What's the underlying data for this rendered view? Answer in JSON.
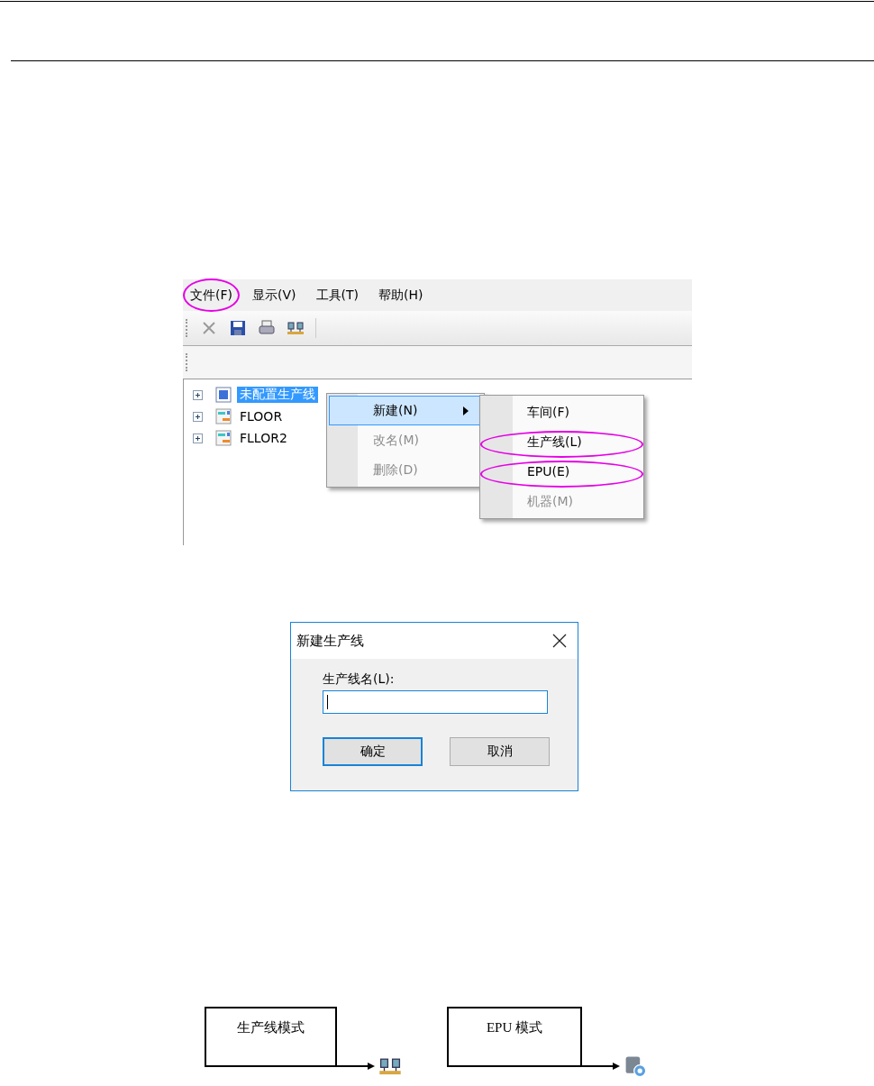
{
  "menubar": [
    {
      "label": "文件(F)",
      "circled": true
    },
    {
      "label": "显示(V)",
      "circled": false
    },
    {
      "label": "工具(T)",
      "circled": false
    },
    {
      "label": "帮助(H)",
      "circled": false
    }
  ],
  "tree": [
    {
      "label": "未配置生产线",
      "selected": true,
      "kind": "line"
    },
    {
      "label": "FLOOR",
      "selected": false,
      "kind": "floor"
    },
    {
      "label": "FLLOR2",
      "selected": false,
      "kind": "floor"
    }
  ],
  "context_menu": [
    {
      "label": "新建(N)",
      "selected": true,
      "disabled": false,
      "has_submenu": true
    },
    {
      "label": "改名(M)",
      "selected": false,
      "disabled": true,
      "has_submenu": false
    },
    {
      "label": "删除(D)",
      "selected": false,
      "disabled": true,
      "has_submenu": false
    }
  ],
  "submenu": [
    {
      "label": "车间(F)",
      "disabled": false,
      "circled": false
    },
    {
      "label": "生产线(L)",
      "disabled": false,
      "circled": true
    },
    {
      "label": "EPU(E)",
      "disabled": false,
      "circled": true
    },
    {
      "label": "机器(M)",
      "disabled": true,
      "circled": false
    }
  ],
  "dialog": {
    "title": "新建生产线",
    "field_label": "生产线名(L):",
    "buttons": [
      {
        "label": "确定",
        "default": true
      },
      {
        "label": "取消",
        "default": false
      }
    ]
  },
  "diagrams": [
    {
      "label": "生产线模式",
      "kind": "line"
    },
    {
      "label": "EPU 模式",
      "kind": "epu"
    }
  ]
}
